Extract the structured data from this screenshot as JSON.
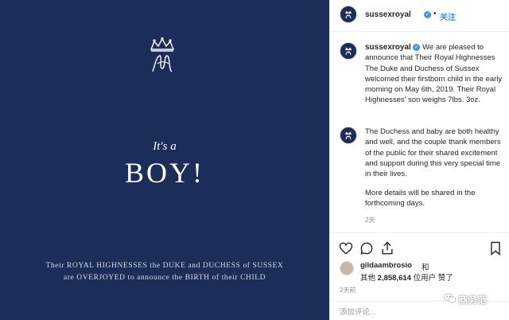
{
  "image": {
    "its_a": "It's a",
    "boy": "BOY!",
    "caption_line1": "Their ROYAL HIGHNESSES the DUKE and DUCHESS of SUSSEX",
    "caption_line2": "are OVERJOYED to announce the BIRTH of their CHILD",
    "background_color": "#1d2d5a",
    "monogram_icon": "crown-monogram-icon"
  },
  "header": {
    "username": "sussexroyal",
    "separator": "•",
    "follow_label": "关注"
  },
  "comments": [
    {
      "username": "sussexroyal",
      "text": "We are pleased to announce that Their Royal Highnesses The Duke and Duchess of Sussex welcomed their firstborn child in the early morning on May 6th, 2019. Their Royal Highnesses' son weighs 7lbs. 3oz."
    },
    {
      "text": "The Duchess and baby are both healthy and well, and the couple thank members of the public for their shared excitement and support during this very special time in their lives.",
      "more": "More details will be shared in the forthcoming days.",
      "age": "2天"
    }
  ],
  "likes": {
    "liker": "gildaambrosio",
    "conjunction": "和",
    "prefix": "其他",
    "count": "2,858,614",
    "suffix": "位用户 赞了"
  },
  "post_time": "2天前",
  "comment_box": {
    "placeholder": "添加评论..."
  },
  "watermark": {
    "text": "商务范"
  },
  "colors": {
    "accent": "#3897f0",
    "navy": "#1d2d5a"
  }
}
